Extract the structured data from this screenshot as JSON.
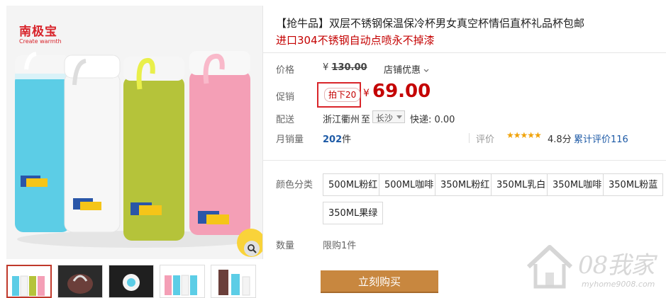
{
  "brand": {
    "name": "南极宝",
    "tagline": "Create warmth"
  },
  "product": {
    "title": "【抢牛品】双层不锈钢保温保冷杯男女真空杯情侣直杯礼品杯包邮",
    "subtitle": "进口304不锈钢自动点喷永不掉漆"
  },
  "price": {
    "label": "价格",
    "currency": "¥",
    "original": "130.00",
    "shop_discount": "店铺优惠"
  },
  "promo": {
    "label": "促销",
    "tag": "拍下20",
    "currency": "¥",
    "price": "69.00"
  },
  "delivery": {
    "label": "配送",
    "from": "浙江衢州",
    "to_word": "至",
    "destination": "长沙",
    "fee": "快递: 0.00"
  },
  "sales": {
    "label": "月销量",
    "count": "202",
    "unit": "件",
    "rating_label": "评价",
    "stars": "★★★★★",
    "score": "4.8分",
    "total_reviews": "累计评价116"
  },
  "options": {
    "label": "颜色分类",
    "items": [
      "500ML粉红",
      "500ML咖啡",
      "350ML粉红",
      "350ML乳白",
      "350ML咖啡",
      "350ML粉蓝",
      "350ML果绿"
    ]
  },
  "quantity": {
    "label": "数量",
    "limit": "限购1件"
  },
  "buy_button": "立刻购买",
  "watermark": {
    "text": "08我家",
    "url": "myhome9008.com"
  },
  "colors": {
    "cup_blue": "#5ccde6",
    "cup_white": "#f4f4f4",
    "cup_lime": "#b5c33a",
    "cup_pink": "#f49fb6",
    "price_red": "#c40000",
    "buy_button": "#c8873f",
    "link_blue": "#1d5aa6"
  },
  "icons": [
    "zoom-icon",
    "chevron-down-icon",
    "star-icon",
    "home-watermark-icon"
  ]
}
